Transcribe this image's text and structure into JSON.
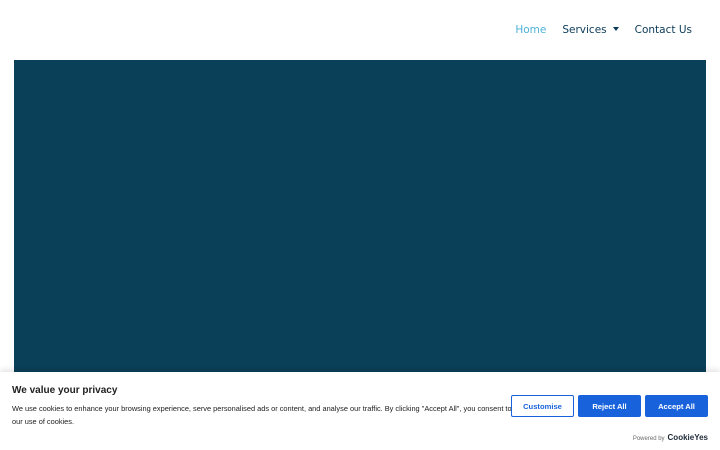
{
  "nav": {
    "items": [
      {
        "label": "Home",
        "active": true
      },
      {
        "label": "Services",
        "has_dropdown": true
      },
      {
        "label": "Contact Us"
      }
    ]
  },
  "hero": {
    "background_color": "#0b4059"
  },
  "cookie_banner": {
    "title": "We value your privacy",
    "text": "We use cookies to enhance your browsing experience, serve personalised ads or content, and analyse our traffic. By clicking \"Accept All\", you consent to our use of cookies.",
    "buttons": {
      "customise": "Customise",
      "reject": "Reject All",
      "accept": "Accept All"
    },
    "powered_by": "Powered by",
    "brand": "CookieYes",
    "accent_color": "#1863dc"
  },
  "colors": {
    "nav_text": "#0b3a57",
    "nav_active": "#4db1d8"
  }
}
